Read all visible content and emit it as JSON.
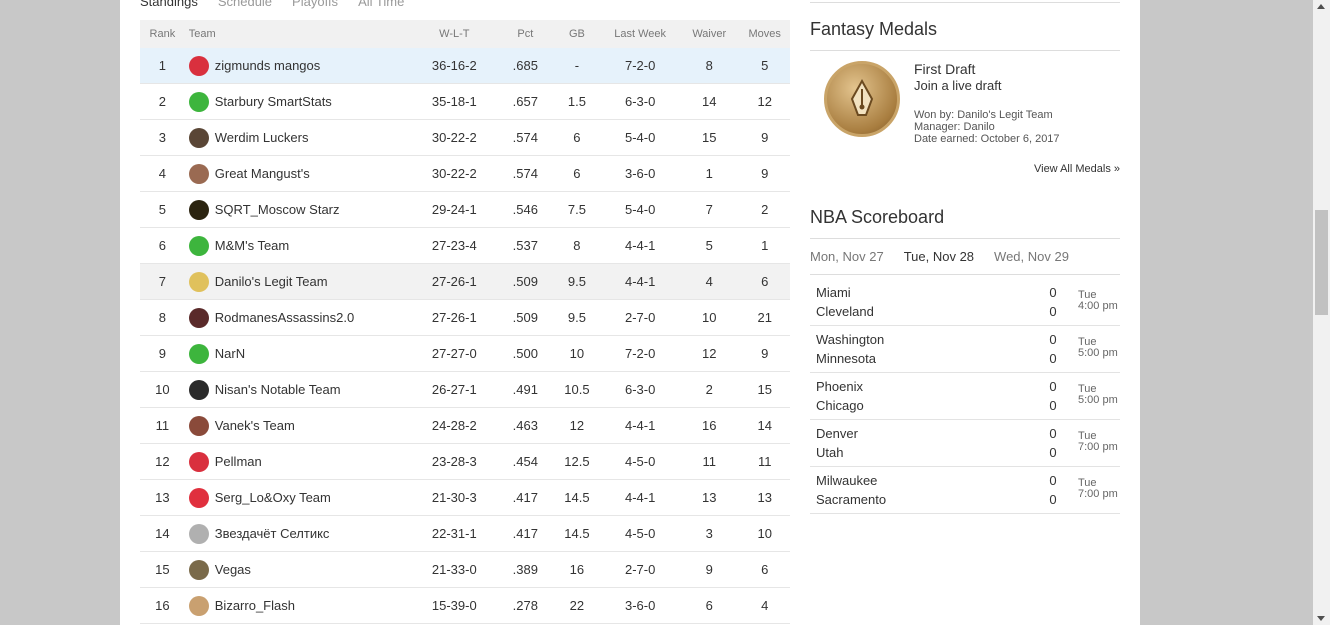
{
  "tabs": [
    "Standings",
    "Schedule",
    "Playoffs",
    "All Time"
  ],
  "standings": {
    "headers": [
      "Rank",
      "Team",
      "W-L-T",
      "Pct",
      "GB",
      "Last Week",
      "Waiver",
      "Moves"
    ],
    "rows": [
      {
        "rank": "1",
        "team": "zigmunds mangos",
        "wlt": "36-16-2",
        "pct": ".685",
        "gb": "-",
        "lw": "7-2-0",
        "waiver": "8",
        "moves": "5",
        "color": "#d9303e"
      },
      {
        "rank": "2",
        "team": "Starbury SmartStats",
        "wlt": "35-18-1",
        "pct": ".657",
        "gb": "1.5",
        "lw": "6-3-0",
        "waiver": "14",
        "moves": "12",
        "color": "#3db53d"
      },
      {
        "rank": "3",
        "team": "Werdim Luckers",
        "wlt": "30-22-2",
        "pct": ".574",
        "gb": "6",
        "lw": "5-4-0",
        "waiver": "15",
        "moves": "9",
        "color": "#5a4636"
      },
      {
        "rank": "4",
        "team": "Great Mangust's",
        "wlt": "30-22-2",
        "pct": ".574",
        "gb": "6",
        "lw": "3-6-0",
        "waiver": "1",
        "moves": "9",
        "color": "#9a6a52"
      },
      {
        "rank": "5",
        "team": "SQRT_Moscow Starz",
        "wlt": "29-24-1",
        "pct": ".546",
        "gb": "7.5",
        "lw": "5-4-0",
        "waiver": "7",
        "moves": "2",
        "color": "#2b2410"
      },
      {
        "rank": "6",
        "team": "M&M's Team",
        "wlt": "27-23-4",
        "pct": ".537",
        "gb": "8",
        "lw": "4-4-1",
        "waiver": "5",
        "moves": "1",
        "color": "#3db53d"
      },
      {
        "rank": "7",
        "team": "Danilo's Legit Team",
        "wlt": "27-26-1",
        "pct": ".509",
        "gb": "9.5",
        "lw": "4-4-1",
        "waiver": "4",
        "moves": "6",
        "color": "#e0c15c"
      },
      {
        "rank": "8",
        "team": "RodmanesAssassins2.0",
        "wlt": "27-26-1",
        "pct": ".509",
        "gb": "9.5",
        "lw": "2-7-0",
        "waiver": "10",
        "moves": "21",
        "color": "#5a2a2a"
      },
      {
        "rank": "9",
        "team": "NarN",
        "wlt": "27-27-0",
        "pct": ".500",
        "gb": "10",
        "lw": "7-2-0",
        "waiver": "12",
        "moves": "9",
        "color": "#3db53d"
      },
      {
        "rank": "10",
        "team": "Nisan's Notable Team",
        "wlt": "26-27-1",
        "pct": ".491",
        "gb": "10.5",
        "lw": "6-3-0",
        "waiver": "2",
        "moves": "15",
        "color": "#2a2a2a"
      },
      {
        "rank": "11",
        "team": "Vanek's Team",
        "wlt": "24-28-2",
        "pct": ".463",
        "gb": "12",
        "lw": "4-4-1",
        "waiver": "16",
        "moves": "14",
        "color": "#8a4a3a"
      },
      {
        "rank": "12",
        "team": "Pellman",
        "wlt": "23-28-3",
        "pct": ".454",
        "gb": "12.5",
        "lw": "4-5-0",
        "waiver": "11",
        "moves": "11",
        "color": "#d9303e"
      },
      {
        "rank": "13",
        "team": "Serg_Lo&Oxy Team",
        "wlt": "21-30-3",
        "pct": ".417",
        "gb": "14.5",
        "lw": "4-4-1",
        "waiver": "13",
        "moves": "13",
        "color": "#e0303e"
      },
      {
        "rank": "14",
        "team": "Звездачёт Селтикс",
        "wlt": "22-31-1",
        "pct": ".417",
        "gb": "14.5",
        "lw": "4-5-0",
        "waiver": "3",
        "moves": "10",
        "color": "#b0b0b0"
      },
      {
        "rank": "15",
        "team": "Vegas",
        "wlt": "21-33-0",
        "pct": ".389",
        "gb": "16",
        "lw": "2-7-0",
        "waiver": "9",
        "moves": "6",
        "color": "#7a6a4a"
      },
      {
        "rank": "16",
        "team": "Bizarro_Flash",
        "wlt": "15-39-0",
        "pct": ".278",
        "gb": "22",
        "lw": "3-6-0",
        "waiver": "6",
        "moves": "4",
        "color": "#c9a070"
      }
    ]
  },
  "medals": {
    "title": "Fantasy Medals",
    "name": "First Draft",
    "desc": "Join a live draft",
    "won_by": "Won by: Danilo's Legit Team",
    "manager": "Manager: Danilo",
    "date": "Date earned: October 6, 2017",
    "view_all": "View All Medals »"
  },
  "scoreboard": {
    "title": "NBA Scoreboard",
    "days": [
      "Mon, Nov 27",
      "Tue, Nov 28",
      "Wed, Nov 29"
    ],
    "games": [
      {
        "home": "Miami",
        "away": "Cleveland",
        "s1": "0",
        "s2": "0",
        "day": "Tue",
        "time": "4:00 pm"
      },
      {
        "home": "Washington",
        "away": "Minnesota",
        "s1": "0",
        "s2": "0",
        "day": "Tue",
        "time": "5:00 pm"
      },
      {
        "home": "Phoenix",
        "away": "Chicago",
        "s1": "0",
        "s2": "0",
        "day": "Tue",
        "time": "5:00 pm"
      },
      {
        "home": "Denver",
        "away": "Utah",
        "s1": "0",
        "s2": "0",
        "day": "Tue",
        "time": "7:00 pm"
      },
      {
        "home": "Milwaukee",
        "away": "Sacramento",
        "s1": "0",
        "s2": "0",
        "day": "Tue",
        "time": "7:00 pm"
      }
    ]
  }
}
